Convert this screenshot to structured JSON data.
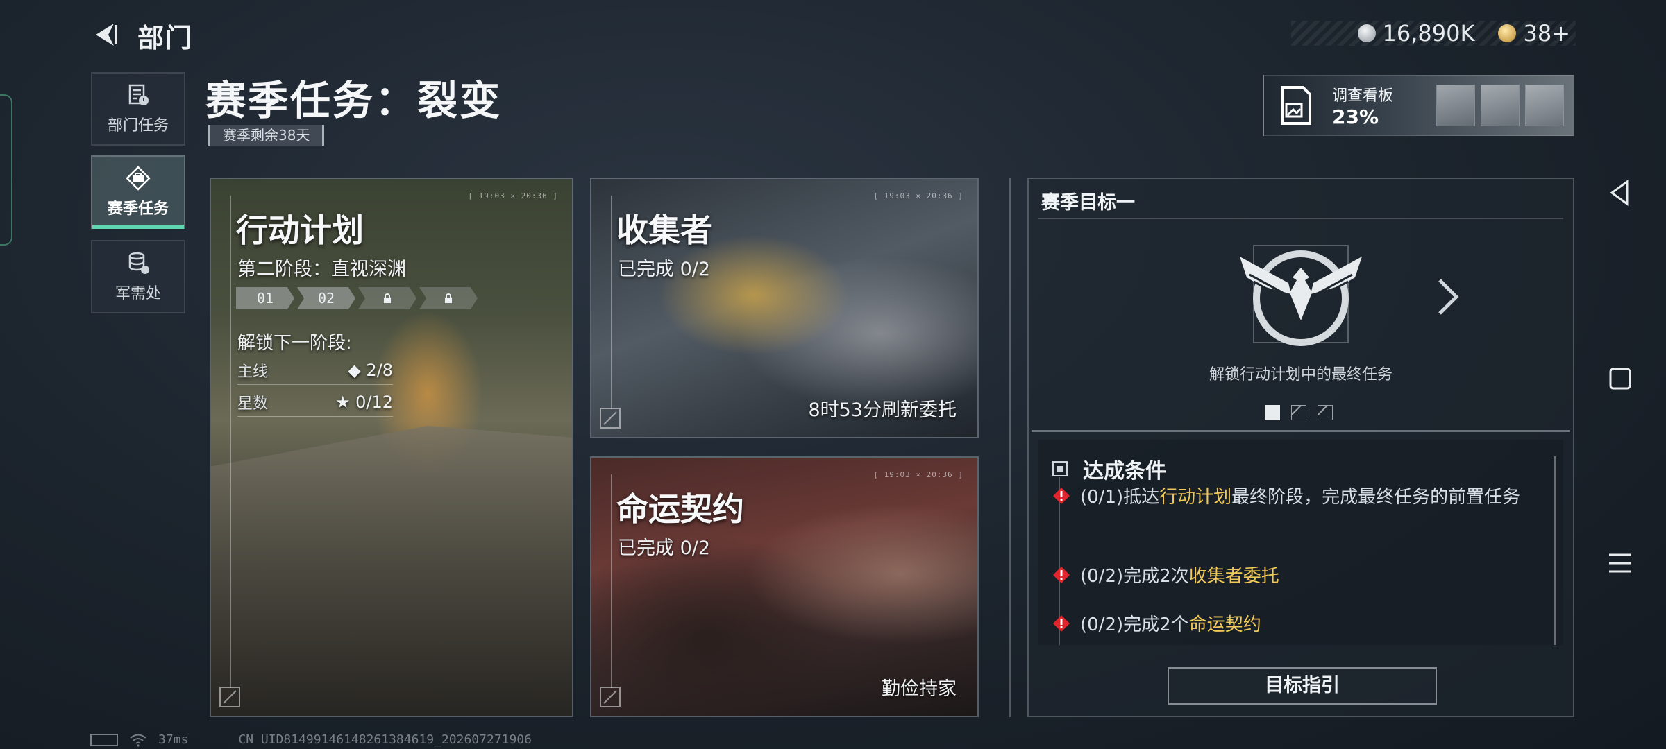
{
  "header": {
    "title": "部门",
    "currency": [
      {
        "icon": "silver-coin-icon",
        "value": "16,890K"
      },
      {
        "icon": "gold-coin-icon",
        "value": "38+"
      }
    ]
  },
  "sidebar": {
    "items": [
      {
        "label": "部门任务",
        "icon": "department-task-icon",
        "active": false
      },
      {
        "label": "赛季任务",
        "icon": "season-task-icon",
        "active": true
      },
      {
        "label": "军需处",
        "icon": "supply-icon",
        "active": false
      }
    ]
  },
  "main": {
    "title": "赛季任务：裂变",
    "remaining": "赛季剩余38天"
  },
  "survey": {
    "label": "调查看板",
    "percent": "23%",
    "progress": 0.23
  },
  "cards": {
    "plan": {
      "timestamp": "[ 19:03 × 20:36 ]",
      "title": "行动计划",
      "stage": "第二阶段：直视深渊",
      "stages": [
        "01",
        "02",
        "locked",
        "locked"
      ],
      "unlock_label": "解锁下一阶段:",
      "rows": [
        {
          "key": "主线",
          "value": "◆ 2/8"
        },
        {
          "key": "星数",
          "value": "★ 0/12"
        }
      ]
    },
    "collector": {
      "timestamp": "[ 19:03 × 20:36 ]",
      "title": "收集者",
      "progress": "已完成 0/2",
      "footer": "8时53分刷新委托"
    },
    "fate": {
      "timestamp": "[ 19:03 × 20:36 ]",
      "title": "命运契约",
      "progress": "已完成 0/2",
      "footer": "勤俭持家"
    }
  },
  "goal": {
    "title": "赛季目标一",
    "emblem_icon": "eagle-emblem-icon",
    "description": "解锁行动计划中的最终任务",
    "pages": 3,
    "current_page": 1,
    "conditions_title": "达成条件",
    "conditions": [
      {
        "prefix": "(0/1)抵达",
        "highlight": "行动计划",
        "suffix": "最终阶段，完成最终任务的前置任务"
      },
      {
        "prefix": "(0/2)完成2次",
        "highlight": "收集者委托",
        "suffix": ""
      },
      {
        "prefix": "(0/2)完成2个",
        "highlight": "命运契约",
        "suffix": ""
      }
    ],
    "guide_button": "目标指引"
  },
  "footer": {
    "ping": "37ms",
    "uid": "CN UID8149914614826138461​9_202607271906"
  },
  "colors": {
    "accent": "#5fd6b0",
    "highlight": "#f0c95a",
    "warning": "#e0262c"
  }
}
